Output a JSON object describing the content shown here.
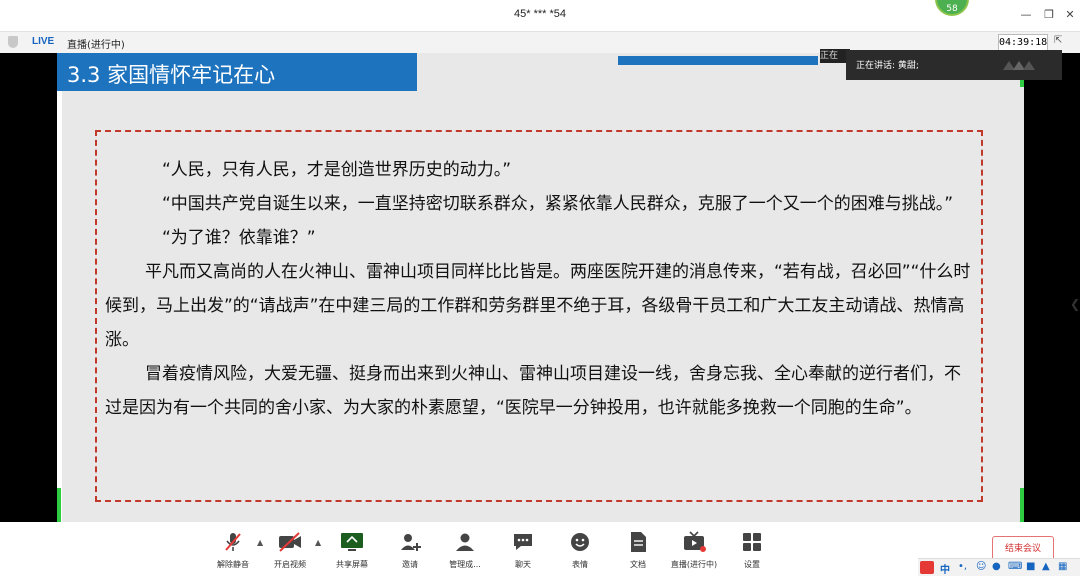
{
  "window": {
    "title": "45* *** *54",
    "participant_count": "58"
  },
  "status": {
    "live_badge": "LIVE",
    "live_status": "直播(进行中)",
    "elapsed": "04:39:18"
  },
  "slide": {
    "heading": "3.3 家国情怀牢记在心",
    "paragraphs": [
      "“人民，只有人民，才是创造世界历史的动力。”",
      "“中国共产党自诞生以来，一直坚持密切联系群众，紧紧依靠人民群众，克服了一个又一个的困难与挑战。”",
      "“为了谁？依靠谁？”",
      "平凡而又高尚的人在火神山、雷神山项目同样比比皆是。两座医院开建的消息传来，“若有战，召必回”“什么时候到，马上出发”的“请战声”在中建三局的工作群和劳务群里不绝于耳，各级骨干员工和广大工友主动请战、热情高涨。",
      "冒着疫情风险，大爱无疆、挺身而出来到火神山、雷神山项目建设一线，舍身忘我、全心奉献的逆行者们，不过是因为有一个共同的舍小家、为大家的朴素愿望，“医院早一分钟投用，也许就能多挽救一个同胞的生命”。"
    ]
  },
  "speaker": {
    "chip": "正在",
    "label": "正在讲话: 黄甜;"
  },
  "toolbar": {
    "unmute": "解除静音",
    "video": "开启视频",
    "share": "共享屏幕",
    "invite": "邀请",
    "members": "管理成...",
    "chat": "聊天",
    "reactions": "表情",
    "docs": "文档",
    "live": "直播(进行中)",
    "settings": "设置",
    "end_meeting": "结束会议"
  },
  "ime": {
    "lang": "中"
  },
  "colors": {
    "accent_blue": "#1e73be",
    "frame_red": "#c0392b",
    "badge_green": "#4caf50",
    "end_red": "#d32f2f"
  }
}
